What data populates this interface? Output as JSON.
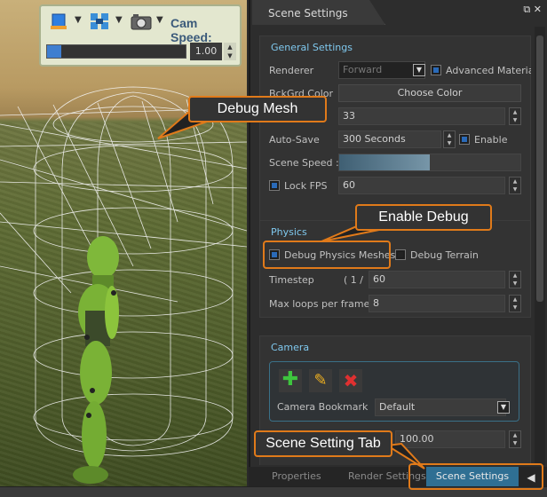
{
  "viewport": {
    "toolbar": {
      "cam_speed_label": "Cam Speed:",
      "cam_speed_value": "1.00",
      "cam_speed_fraction": 0.1
    }
  },
  "panel": {
    "title": "Scene Settings",
    "general": {
      "title": "General Settings",
      "renderer_label": "Renderer",
      "renderer_value": "Forward",
      "advanced_material_label": "Advanced Material",
      "bckgrd_color_label": "BckGrd Color",
      "choose_color_label": "Choose Color",
      "value_33": "33",
      "autosave_label": "Auto-Save",
      "autosave_value": "300 Seconds",
      "enable_label": "Enable",
      "scene_speed_label": "Scene Speed :",
      "scene_speed_fraction": 0.5,
      "lock_fps_label": "Lock FPS",
      "lock_fps_value": "60"
    },
    "physics": {
      "title": "Physics",
      "debug_meshes_label": "Debug Physics Meshes",
      "debug_terrain_label": "Debug Terrain",
      "timestep_label": "Timestep",
      "timestep_prefix": "( 1 /",
      "timestep_value": "60",
      "max_loops_label": "Max loops per frame:",
      "max_loops_value": "8"
    },
    "camera": {
      "title": "Camera",
      "bookmark_label": "Camera Bookmark",
      "bookmark_value": "Default",
      "value_100": "100.00"
    }
  },
  "bottom_tabs": {
    "properties": "Properties",
    "render_settings": "Render Settings",
    "scene_settings": "Scene Settings"
  },
  "callouts": {
    "debug_mesh": "Debug Mesh",
    "enable_debug": "Enable Debug",
    "scene_setting_tab": "Scene Setting Tab"
  },
  "colors": {
    "accent_orange": "#e07a1a",
    "section_title_blue": "#7fc8ee",
    "active_tab_blue": "#2f6f93"
  }
}
